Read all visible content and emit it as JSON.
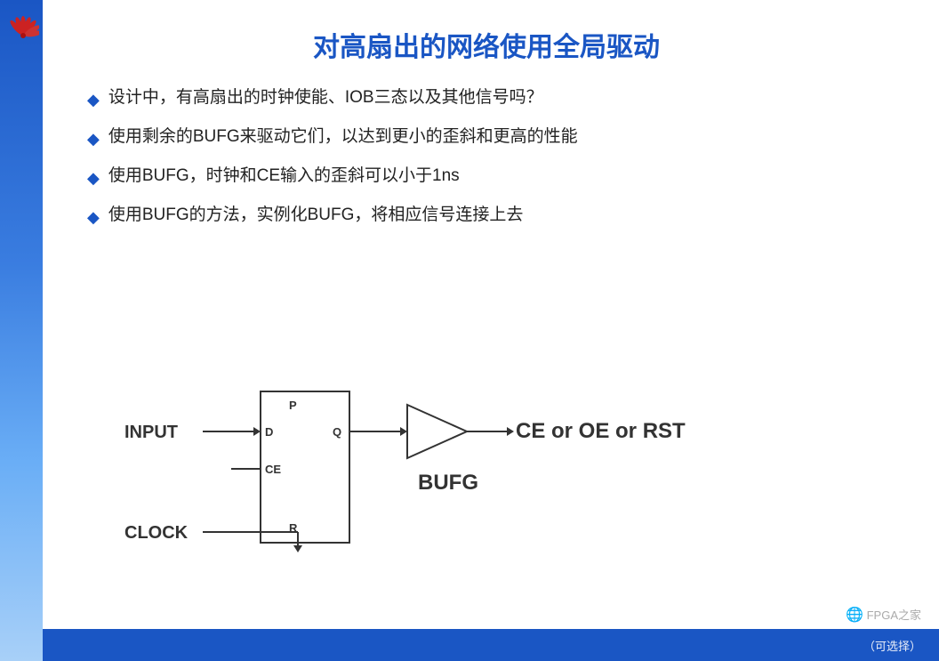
{
  "slide": {
    "title": "对高扇出的网络使用全局驱动",
    "bullets": [
      {
        "id": 1,
        "text": "设计中，有高扇出的时钟使能、IOB三态以及其他信号吗？"
      },
      {
        "id": 2,
        "text": "使用剩余的BUFG来驱动它们，以达到更小的歪斜和更高的性能"
      },
      {
        "id": 3,
        "text": "使用BUFG，时钟和CE输入的歪斜可以小于1ns"
      },
      {
        "id": 4,
        "text": "使用BUFG的方法，实例化BUFG，将相应信号连接上去"
      }
    ],
    "diagram": {
      "input_label": "INPUT",
      "clock_label": "CLOCK",
      "bufg_label": "BUFG",
      "output_label": "CE or OE or RST",
      "dff_pins": {
        "p": "P",
        "d": "D",
        "q": "Q",
        "ce": "CE",
        "r": "R"
      }
    },
    "watermark": "FPGA之家",
    "bottom_note": "（可选择）"
  },
  "leftbar": {
    "color": "#1a56c4"
  }
}
